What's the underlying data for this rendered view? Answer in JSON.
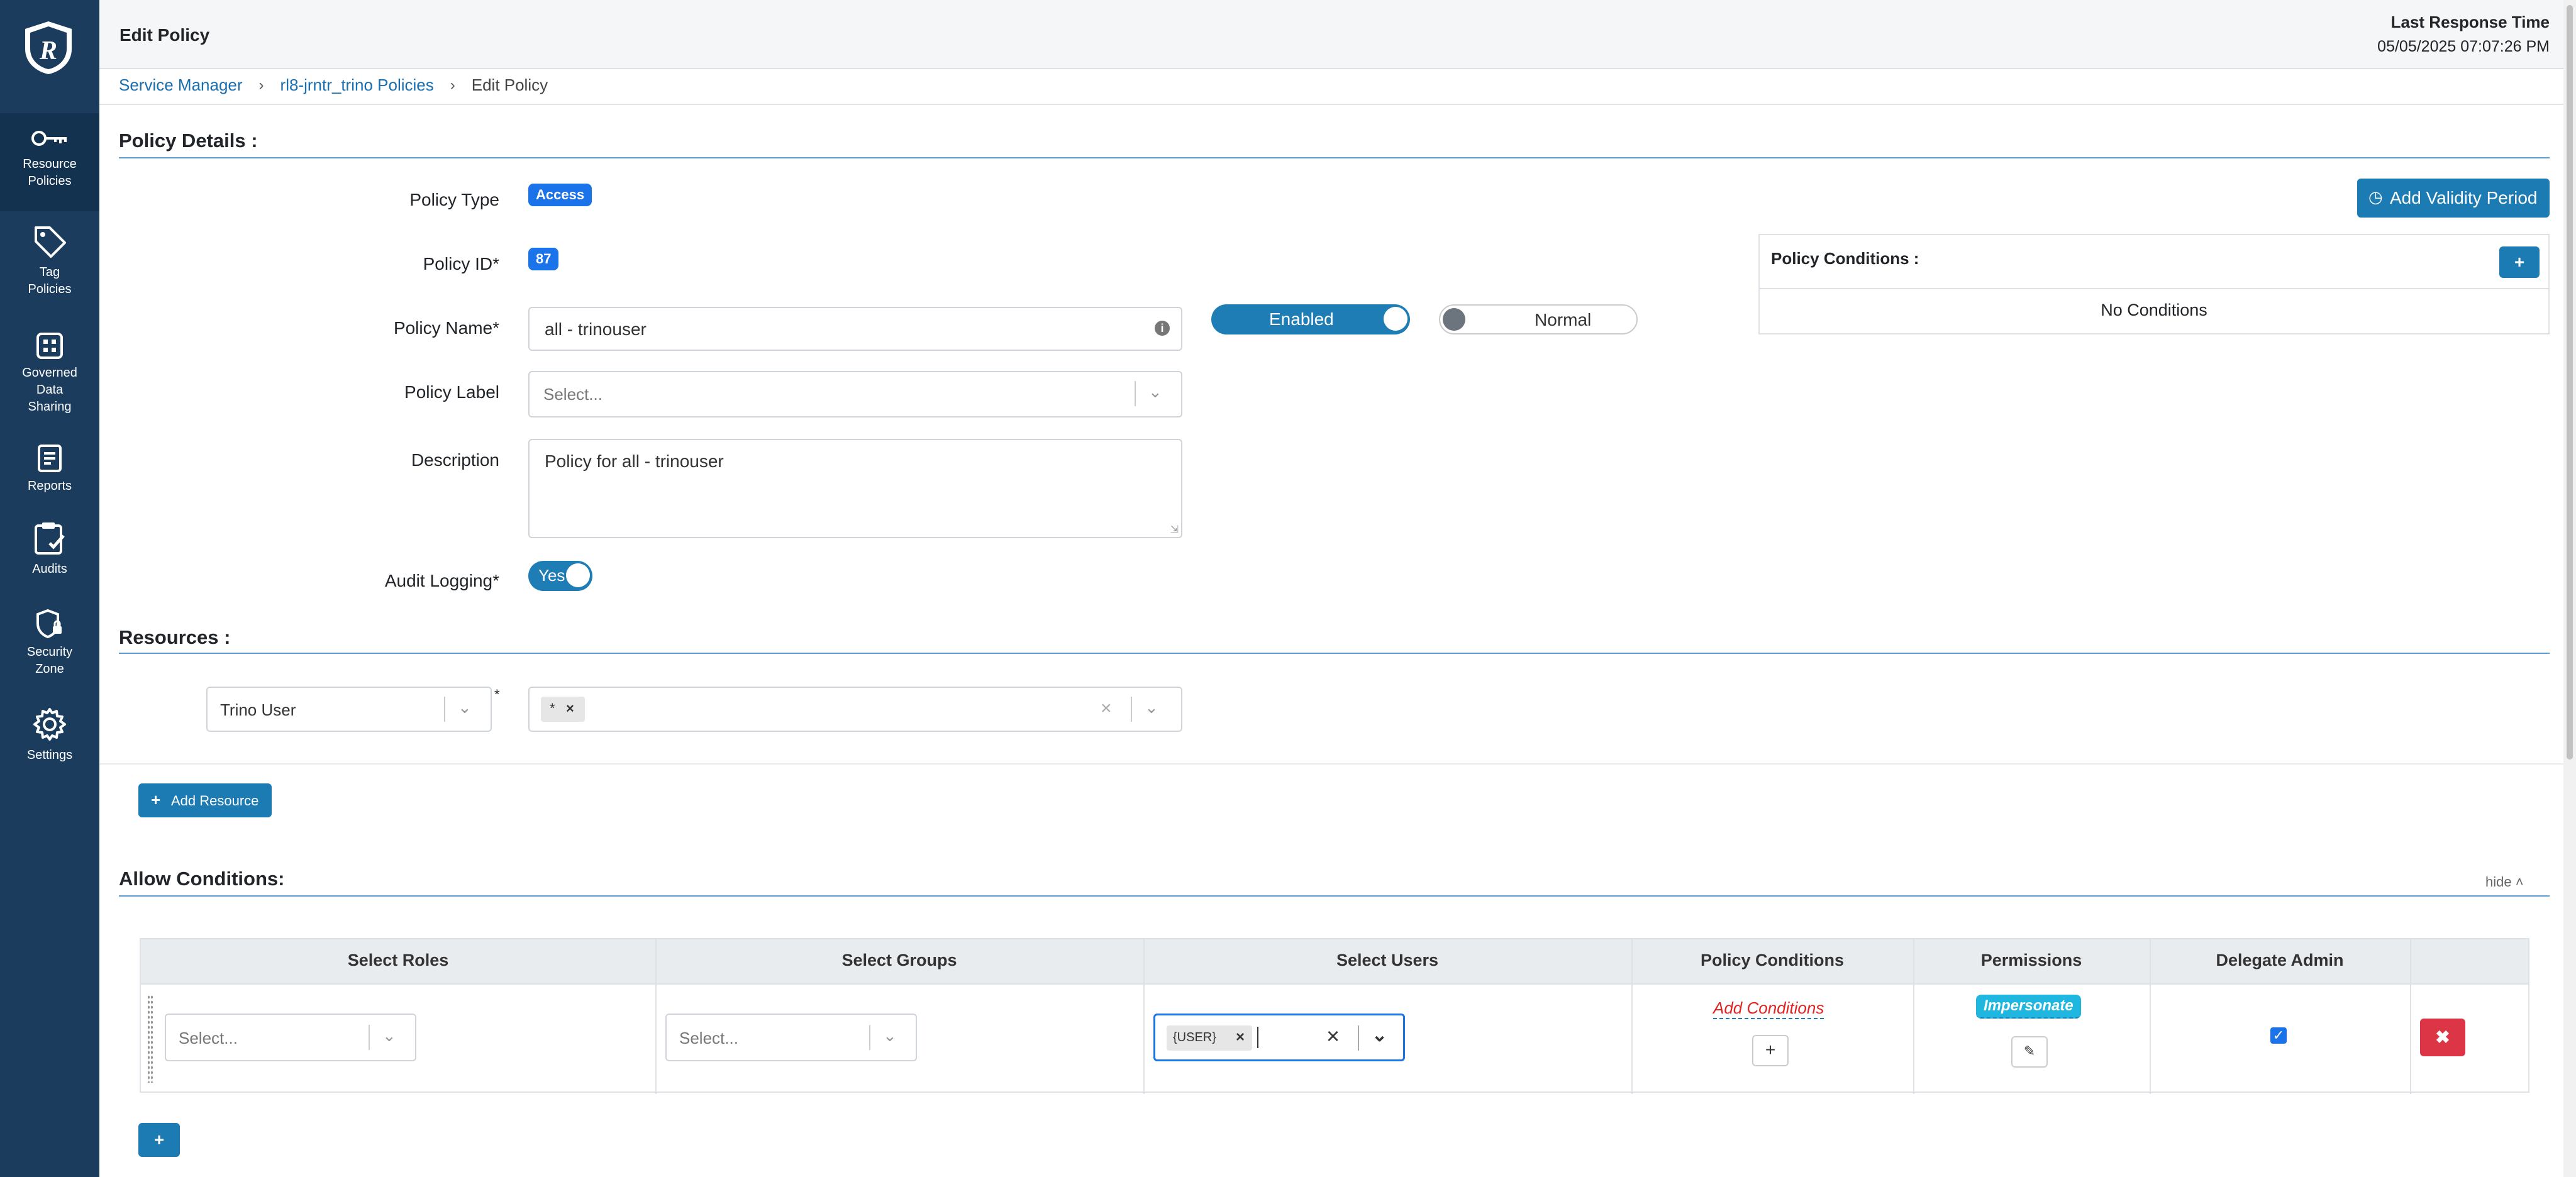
{
  "header": {
    "title": "Edit Policy",
    "response_label": "Last Response Time",
    "response_value": "05/05/2025 07:07:26 PM"
  },
  "sidebar": {
    "items": [
      {
        "label_1": "Resource",
        "label_2": "Policies",
        "icon": "key-icon",
        "active": true
      },
      {
        "label_1": "Tag",
        "label_2": "Policies",
        "icon": "tag-icon"
      },
      {
        "label_1": "Governed",
        "label_2": "Data",
        "label_3": "Sharing",
        "icon": "grid-icon"
      },
      {
        "label_1": "Reports",
        "icon": "report-icon"
      },
      {
        "label_1": "Audits",
        "icon": "clipboard-check-icon"
      },
      {
        "label_1": "Security",
        "label_2": "Zone",
        "icon": "shield-lock-icon"
      },
      {
        "label_1": "Settings",
        "icon": "gear-icon"
      }
    ]
  },
  "breadcrumb": {
    "items": [
      "Service Manager",
      "rl8-jrntr_trino Policies",
      "Edit Policy"
    ]
  },
  "policy_details": {
    "section_title": "Policy Details :",
    "policy_type_label": "Policy Type",
    "policy_type_value": "Access",
    "policy_id_label": "Policy ID*",
    "policy_id_value": "87",
    "policy_name_label": "Policy Name*",
    "policy_name_value": "all - trinouser",
    "enabled_toggle": "Enabled",
    "normal_toggle": "Normal",
    "policy_label_label": "Policy Label",
    "policy_label_placeholder": "Select...",
    "description_label": "Description",
    "description_value": "Policy for all - trinouser",
    "audit_label": "Audit Logging*",
    "audit_value": "Yes",
    "add_validity_button": "Add Validity Period",
    "conditions_title": "Policy Conditions :",
    "conditions_empty": "No Conditions"
  },
  "resources": {
    "section_title": "Resources :",
    "resource_type": "Trino User",
    "required_mark": "*",
    "resource_value_tag": "*",
    "add_resource_button": "Add Resource"
  },
  "allow_conditions": {
    "section_title": "Allow Conditions:",
    "hide_link": "hide",
    "columns": [
      "Select Roles",
      "Select Groups",
      "Select Users",
      "Policy Conditions",
      "Permissions",
      "Delegate Admin"
    ],
    "row": {
      "roles_placeholder": "Select...",
      "groups_placeholder": "Select...",
      "user_tag": "{USER}",
      "add_conditions_link": "Add Conditions",
      "permission_badge": "Impersonate",
      "delegate_admin": true
    }
  }
}
